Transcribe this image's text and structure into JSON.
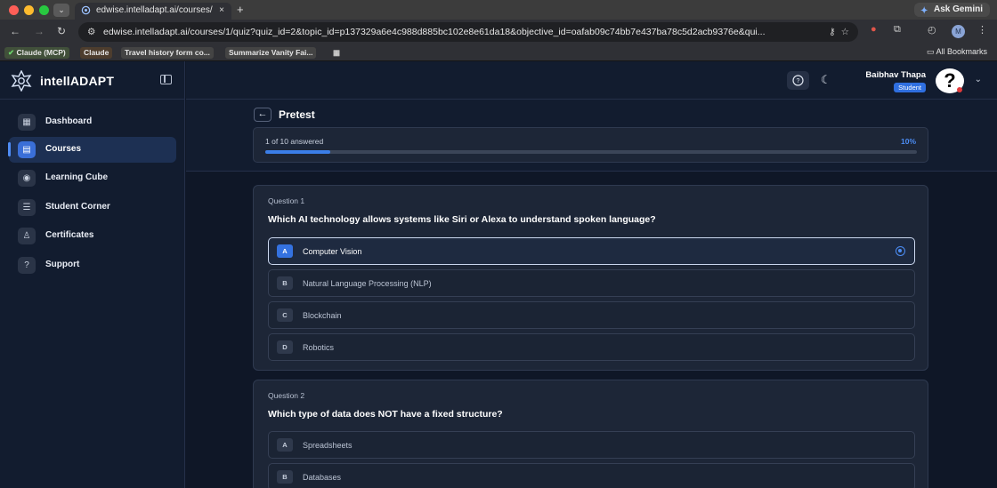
{
  "browser": {
    "tab_title": "edwise.intelladapt.ai/courses/",
    "url": "edwise.intelladapt.ai/courses/1/quiz?quiz_id=2&topic_id=p137329a6e4c988d885bc102e8e61da18&objective_id=oafab09c74bb7e437ba78c5d2acb9376e&qui...",
    "gemini_label": "Ask Gemini",
    "profile_initial": "M",
    "bookmarks": [
      "Claude (MCP)",
      "Claude",
      "Travel history form co...",
      "Summarize Vanity Fai..."
    ],
    "all_bookmarks": "All Bookmarks"
  },
  "app": {
    "brand": "intellADAPT",
    "nav": [
      {
        "label": "Dashboard",
        "icon": "dashboard-icon"
      },
      {
        "label": "Courses",
        "icon": "courses-icon",
        "active": true
      },
      {
        "label": "Learning Cube",
        "icon": "learning-cube-icon"
      },
      {
        "label": "Student Corner",
        "icon": "student-corner-icon"
      },
      {
        "label": "Certificates",
        "icon": "certificate-icon"
      },
      {
        "label": "Support",
        "icon": "support-icon"
      }
    ],
    "user": {
      "name": "Baibhav Thapa",
      "role": "Student",
      "avatar": "?"
    }
  },
  "quiz": {
    "title": "Pretest",
    "progress_text": "1 of 10 answered",
    "progress_pct": "10%",
    "progress_fraction": 0.1,
    "questions": [
      {
        "number": "Question 1",
        "text": "Which AI technology allows systems like Siri or Alexa to understand spoken language?",
        "options": [
          {
            "letter": "A",
            "text": "Computer Vision",
            "selected": true
          },
          {
            "letter": "B",
            "text": "Natural Language Processing (NLP)"
          },
          {
            "letter": "C",
            "text": "Blockchain"
          },
          {
            "letter": "D",
            "text": "Robotics"
          }
        ]
      },
      {
        "number": "Question 2",
        "text": "Which type of data does NOT have a fixed structure?",
        "options": [
          {
            "letter": "A",
            "text": "Spreadsheets"
          },
          {
            "letter": "B",
            "text": "Databases"
          }
        ]
      }
    ]
  },
  "colors": {
    "accent": "#3b7ee8",
    "sidebar_bg": "#121c2f",
    "page_bg": "#0f1727",
    "card_bg": "#1d2637"
  }
}
